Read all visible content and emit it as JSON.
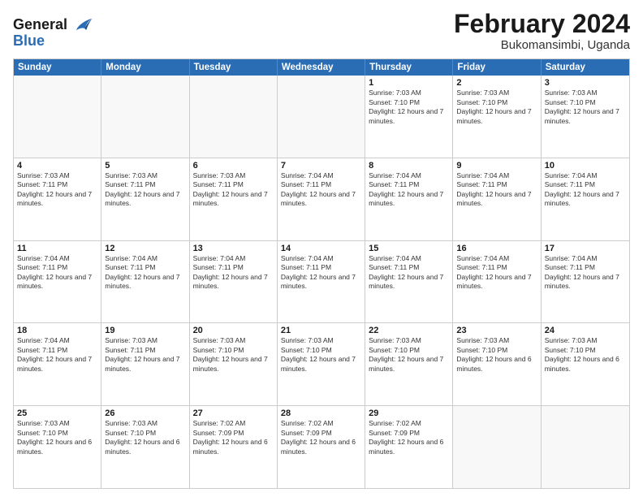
{
  "header": {
    "logo_line1": "General",
    "logo_line2": "Blue",
    "month_title": "February 2024",
    "location": "Bukomansimbi, Uganda"
  },
  "calendar": {
    "days_of_week": [
      "Sunday",
      "Monday",
      "Tuesday",
      "Wednesday",
      "Thursday",
      "Friday",
      "Saturday"
    ],
    "rows": [
      [
        {
          "day": "",
          "empty": true
        },
        {
          "day": "",
          "empty": true
        },
        {
          "day": "",
          "empty": true
        },
        {
          "day": "",
          "empty": true
        },
        {
          "day": "1",
          "sunrise": "7:03 AM",
          "sunset": "7:10 PM",
          "daylight": "12 hours and 7 minutes."
        },
        {
          "day": "2",
          "sunrise": "7:03 AM",
          "sunset": "7:10 PM",
          "daylight": "12 hours and 7 minutes."
        },
        {
          "day": "3",
          "sunrise": "7:03 AM",
          "sunset": "7:10 PM",
          "daylight": "12 hours and 7 minutes."
        }
      ],
      [
        {
          "day": "4",
          "sunrise": "7:03 AM",
          "sunset": "7:11 PM",
          "daylight": "12 hours and 7 minutes."
        },
        {
          "day": "5",
          "sunrise": "7:03 AM",
          "sunset": "7:11 PM",
          "daylight": "12 hours and 7 minutes."
        },
        {
          "day": "6",
          "sunrise": "7:03 AM",
          "sunset": "7:11 PM",
          "daylight": "12 hours and 7 minutes."
        },
        {
          "day": "7",
          "sunrise": "7:04 AM",
          "sunset": "7:11 PM",
          "daylight": "12 hours and 7 minutes."
        },
        {
          "day": "8",
          "sunrise": "7:04 AM",
          "sunset": "7:11 PM",
          "daylight": "12 hours and 7 minutes."
        },
        {
          "day": "9",
          "sunrise": "7:04 AM",
          "sunset": "7:11 PM",
          "daylight": "12 hours and 7 minutes."
        },
        {
          "day": "10",
          "sunrise": "7:04 AM",
          "sunset": "7:11 PM",
          "daylight": "12 hours and 7 minutes."
        }
      ],
      [
        {
          "day": "11",
          "sunrise": "7:04 AM",
          "sunset": "7:11 PM",
          "daylight": "12 hours and 7 minutes."
        },
        {
          "day": "12",
          "sunrise": "7:04 AM",
          "sunset": "7:11 PM",
          "daylight": "12 hours and 7 minutes."
        },
        {
          "day": "13",
          "sunrise": "7:04 AM",
          "sunset": "7:11 PM",
          "daylight": "12 hours and 7 minutes."
        },
        {
          "day": "14",
          "sunrise": "7:04 AM",
          "sunset": "7:11 PM",
          "daylight": "12 hours and 7 minutes."
        },
        {
          "day": "15",
          "sunrise": "7:04 AM",
          "sunset": "7:11 PM",
          "daylight": "12 hours and 7 minutes."
        },
        {
          "day": "16",
          "sunrise": "7:04 AM",
          "sunset": "7:11 PM",
          "daylight": "12 hours and 7 minutes."
        },
        {
          "day": "17",
          "sunrise": "7:04 AM",
          "sunset": "7:11 PM",
          "daylight": "12 hours and 7 minutes."
        }
      ],
      [
        {
          "day": "18",
          "sunrise": "7:04 AM",
          "sunset": "7:11 PM",
          "daylight": "12 hours and 7 minutes."
        },
        {
          "day": "19",
          "sunrise": "7:03 AM",
          "sunset": "7:11 PM",
          "daylight": "12 hours and 7 minutes."
        },
        {
          "day": "20",
          "sunrise": "7:03 AM",
          "sunset": "7:10 PM",
          "daylight": "12 hours and 7 minutes."
        },
        {
          "day": "21",
          "sunrise": "7:03 AM",
          "sunset": "7:10 PM",
          "daylight": "12 hours and 7 minutes."
        },
        {
          "day": "22",
          "sunrise": "7:03 AM",
          "sunset": "7:10 PM",
          "daylight": "12 hours and 7 minutes."
        },
        {
          "day": "23",
          "sunrise": "7:03 AM",
          "sunset": "7:10 PM",
          "daylight": "12 hours and 6 minutes."
        },
        {
          "day": "24",
          "sunrise": "7:03 AM",
          "sunset": "7:10 PM",
          "daylight": "12 hours and 6 minutes."
        }
      ],
      [
        {
          "day": "25",
          "sunrise": "7:03 AM",
          "sunset": "7:10 PM",
          "daylight": "12 hours and 6 minutes."
        },
        {
          "day": "26",
          "sunrise": "7:03 AM",
          "sunset": "7:10 PM",
          "daylight": "12 hours and 6 minutes."
        },
        {
          "day": "27",
          "sunrise": "7:02 AM",
          "sunset": "7:09 PM",
          "daylight": "12 hours and 6 minutes."
        },
        {
          "day": "28",
          "sunrise": "7:02 AM",
          "sunset": "7:09 PM",
          "daylight": "12 hours and 6 minutes."
        },
        {
          "day": "29",
          "sunrise": "7:02 AM",
          "sunset": "7:09 PM",
          "daylight": "12 hours and 6 minutes."
        },
        {
          "day": "",
          "empty": true
        },
        {
          "day": "",
          "empty": true
        }
      ]
    ]
  }
}
